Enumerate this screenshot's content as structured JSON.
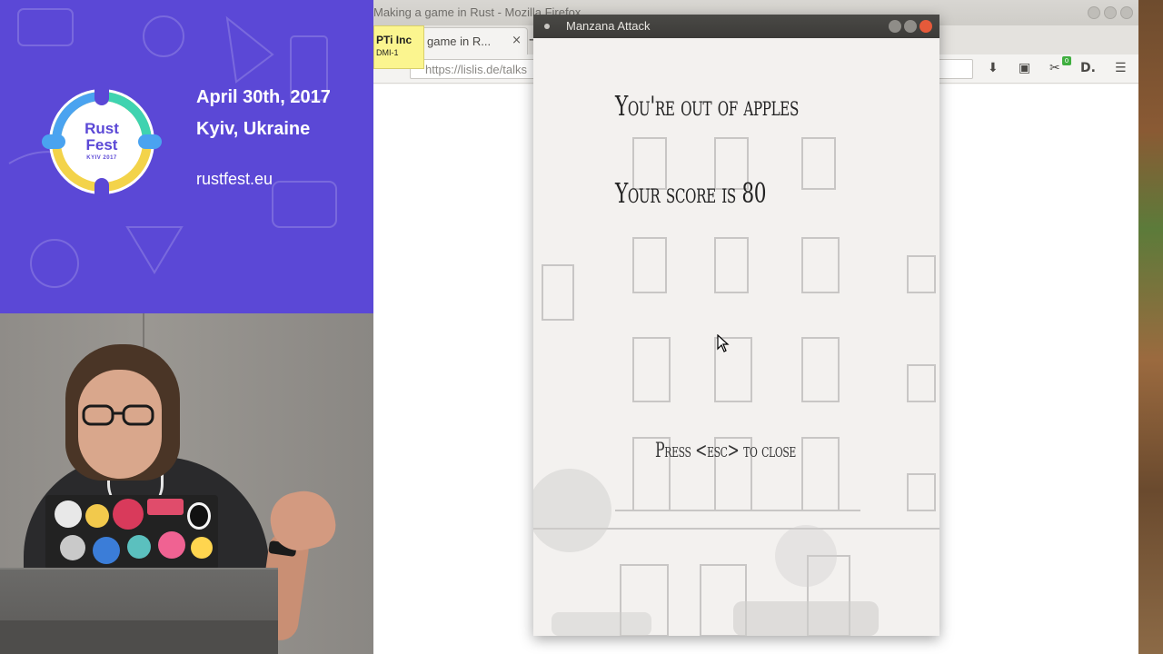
{
  "banner": {
    "logo_line1": "Rust",
    "logo_line2": "Fest",
    "logo_line3": "KYIV 2017",
    "date": "April 30th, 2017",
    "city": "Kyiv, Ukraine",
    "site": "rustfest.eu",
    "background_color": "#5b48d6"
  },
  "firefox": {
    "window_title": "Making a game in Rust - Mozilla Firefox",
    "tab_label": "game in R...",
    "tab_close": "×",
    "new_tab": "+",
    "url": "https://lislis.de/talks",
    "toolbar_icons": [
      "download-icon",
      "pocket-icon",
      "extension-icon",
      "reader-icon",
      "menu-icon"
    ],
    "extension_badge": "0"
  },
  "sticky_note": {
    "title": "PTi Inc",
    "subtitle": "DMI-1"
  },
  "game": {
    "window_title": "Manzana Attack",
    "out_message": "You're out of apples",
    "score_message": "Your score is 80",
    "close_message": "Press <esc> to close",
    "close_button_color": "#e65a3a"
  }
}
